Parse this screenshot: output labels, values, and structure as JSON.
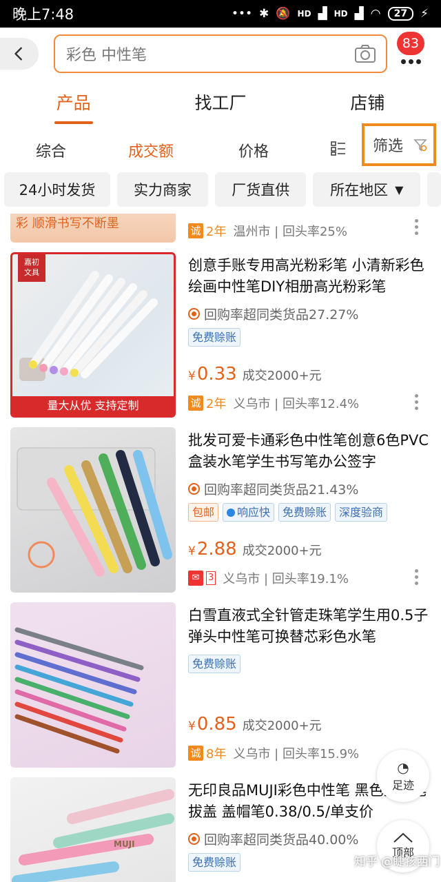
{
  "status_bar": {
    "time": "晚上7:48",
    "signal1": "HD",
    "signal2": "HD",
    "battery": "27"
  },
  "search": {
    "query": "彩色 中性笔",
    "message_count": "83"
  },
  "tabs": [
    {
      "label": "产品",
      "active": true
    },
    {
      "label": "找工厂",
      "active": false
    },
    {
      "label": "店铺",
      "active": false
    }
  ],
  "sort": {
    "comprehensive": "综合",
    "volume": "成交额",
    "price": "价格",
    "filter": "筛选"
  },
  "chips": [
    {
      "label": "24小时发货"
    },
    {
      "label": "实力商家"
    },
    {
      "label": "厂货直供"
    },
    {
      "label": "所在地区"
    }
  ],
  "items": [
    {
      "partial_banner": "彩  顺滑书写不断墨",
      "cheng_label": "诚",
      "years": "2年",
      "meta": "温州市 | 回头率25%"
    },
    {
      "title": "创意手账专用高光粉彩笔 小清新彩色绘画中性笔DIY相册高光粉彩笔",
      "repurchase": "回购率超同类货品27.27%",
      "tags": [
        "免费赊账"
      ],
      "yen": "¥",
      "price": "0.33",
      "sold": "成交2000+元",
      "cheng_label": "诚",
      "years": "2年",
      "meta": "义乌市 | 回头率12.4%",
      "thumb_corner": "嘉初\n文具",
      "thumb_banner": "量大从优  支持定制"
    },
    {
      "title": "批发可爱卡通彩色中性笔创意6色PVC盒装水笔学生书写笔办公签字",
      "repurchase": "回购率超同类货品21.43%",
      "tags": [
        "包邮",
        "响应快",
        "免费赊账",
        "深度验商"
      ],
      "yen": "¥",
      "price": "2.88",
      "sold": "成交2000+元",
      "tm_level": "3",
      "meta": "义乌市 | 回头率19.1%"
    },
    {
      "title": "白雪直液式全针管走珠笔学生用0.5子弹头中性笔可换替芯彩色水笔",
      "tags": [
        "免费赊账"
      ],
      "yen": "¥",
      "price": "0.85",
      "sold": "成交2000+元",
      "cheng_label": "诚",
      "years": "8年",
      "meta": "义乌市 | 回头率15.9%"
    },
    {
      "title": "无印良品MUJI彩色中性笔 黑色签字笔 拔盖 盖帽笔0.38/0.5/单支价",
      "repurchase": "回购率超同类货品40.00%",
      "tags": [
        "免费赊账"
      ],
      "thumb_text": "MUJI"
    }
  ],
  "floating": {
    "footprint": "足迹",
    "top": "顶部"
  },
  "watermark": "知乎 @睫孩西门",
  "colors": {
    "accent": "#e2621b",
    "highlight_border": "#f08a1e",
    "badge": "#ee3333"
  }
}
